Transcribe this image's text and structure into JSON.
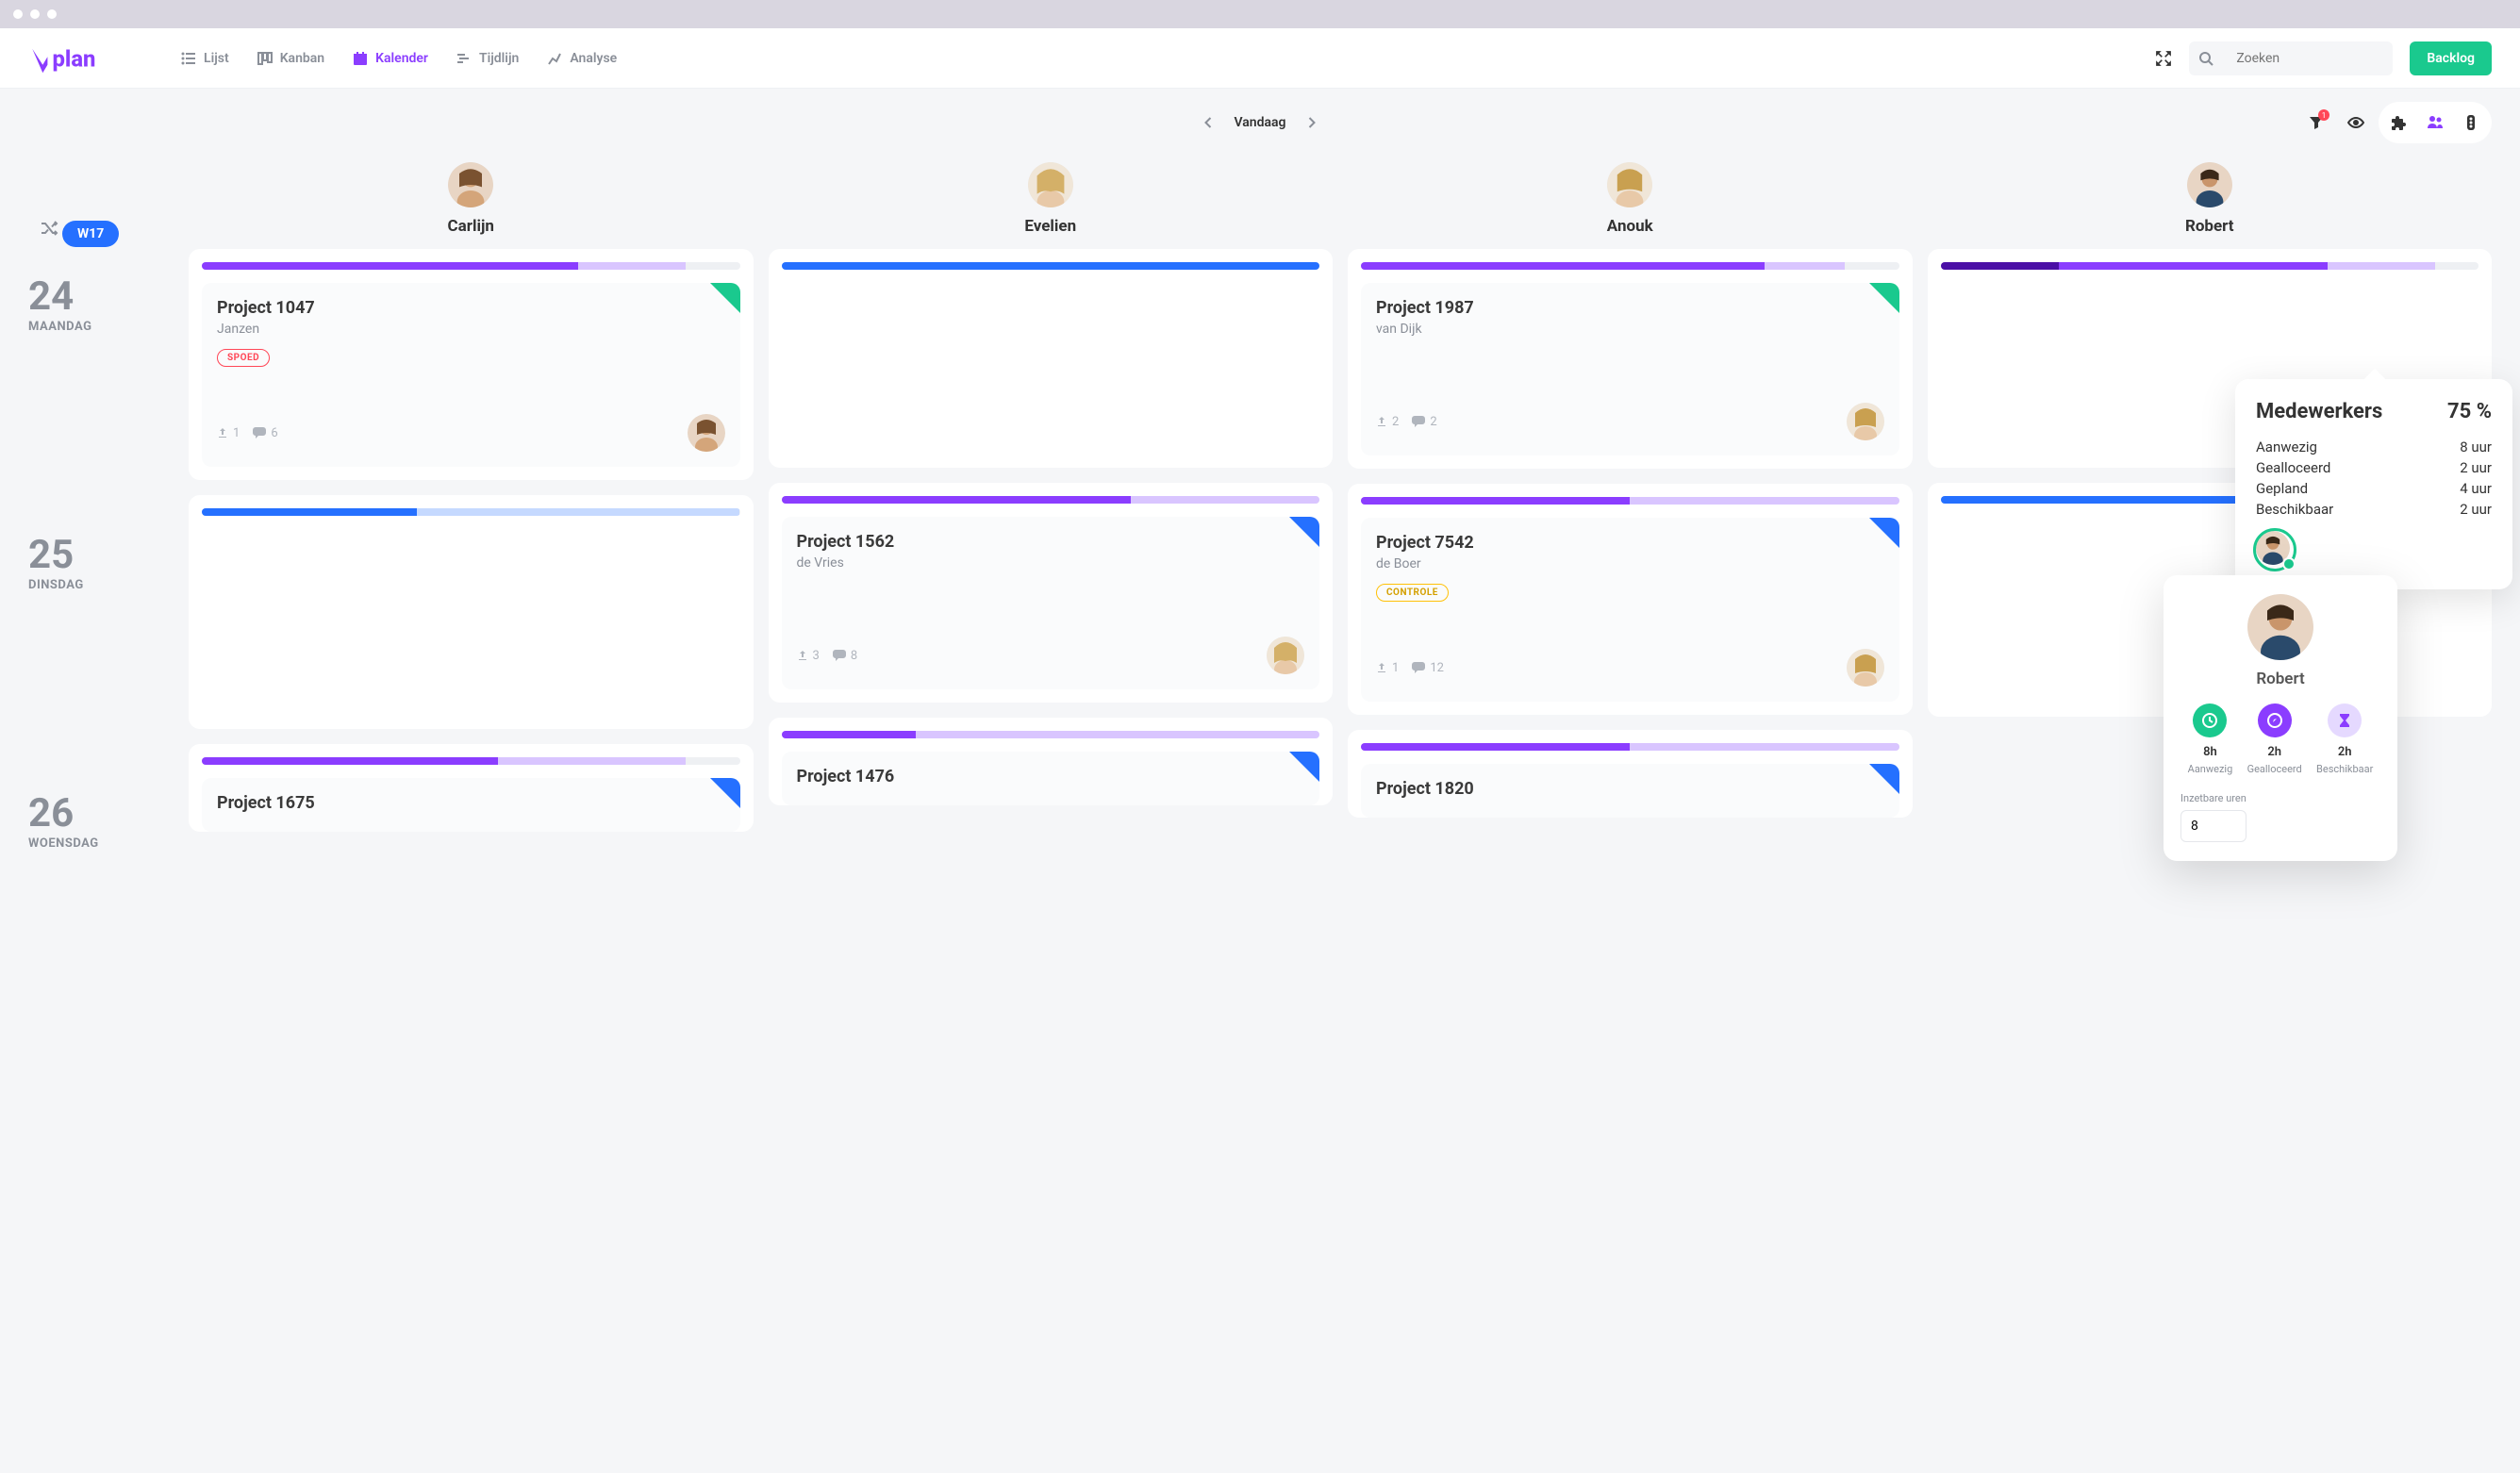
{
  "nav": {
    "lijst": "Lijst",
    "kanban": "Kanban",
    "kalender": "Kalender",
    "tijdlijn": "Tijdlijn",
    "analyse": "Analyse"
  },
  "search": {
    "placeholder": "Zoeken"
  },
  "backlog": "Backlog",
  "today": "Vandaag",
  "filter_badge": "1",
  "week": "W17",
  "days": [
    {
      "num": "24",
      "name": "MAANDAG"
    },
    {
      "num": "25",
      "name": "DINSDAG"
    },
    {
      "num": "26",
      "name": "WOENSDAG"
    }
  ],
  "people": [
    "Carlijn",
    "Evelien",
    "Anouk",
    "Robert"
  ],
  "cards": {
    "c00": {
      "title": "Project 1047",
      "sub": "Janzen",
      "tag": "SPOED",
      "up": "1",
      "chat": "6"
    },
    "c02": {
      "title": "Project 1987",
      "sub": "van Dijk",
      "up": "2",
      "chat": "2"
    },
    "c11": {
      "title": "Project 1562",
      "sub": "de Vries",
      "up": "3",
      "chat": "8"
    },
    "c12": {
      "title": "Project 7542",
      "sub": "de Boer",
      "tag": "CONTROLE",
      "up": "1",
      "chat": "12"
    },
    "c20": {
      "title": "Project 1675"
    },
    "c21": {
      "title": "Project 1476"
    },
    "c22": {
      "title": "Project 1820"
    }
  },
  "medewerkers": {
    "title": "Medewerkers",
    "pct": "75 %",
    "rows": [
      {
        "label": "Aanwezig",
        "val": "8 uur"
      },
      {
        "label": "Gealloceerd",
        "val": "2 uur"
      },
      {
        "label": "Gepland",
        "val": "4 uur"
      },
      {
        "label": "Beschikbaar",
        "val": "2 uur"
      }
    ]
  },
  "robert_pop": {
    "name": "Robert",
    "stats": [
      {
        "val": "8h",
        "label": "Aanwezig"
      },
      {
        "val": "2h",
        "label": "Gealloceerd"
      },
      {
        "val": "2h",
        "label": "Beschikbaar"
      }
    ],
    "input_label": "Inzetbare uren",
    "input_val": "8"
  }
}
